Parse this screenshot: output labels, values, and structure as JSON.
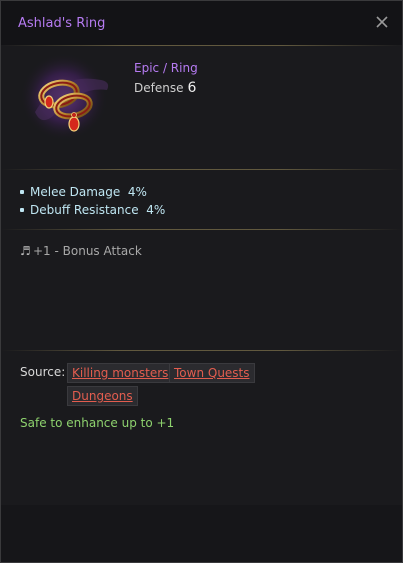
{
  "window": {
    "title": "Ashlad's Ring"
  },
  "item": {
    "icon": "ring-icon",
    "grade_type": "Epic / Ring",
    "defense_label": "Defense",
    "defense_value": "6"
  },
  "stats": [
    {
      "text": "Melee Damage  4%"
    },
    {
      "text": "Debuff Resistance  4%"
    }
  ],
  "bonus": {
    "icon": "music-note-icon",
    "text": "+1 - Bonus Attack"
  },
  "source": {
    "label": "Source:",
    "links": [
      "Killing monsters",
      "Town Quests",
      "Dungeons"
    ]
  },
  "enhance_text": "Safe to enhance up to +1",
  "colors": {
    "title": "#b67bf2",
    "stat": "#bfe6f2",
    "link": "#e35d4f",
    "enhance": "#8ed26e"
  }
}
